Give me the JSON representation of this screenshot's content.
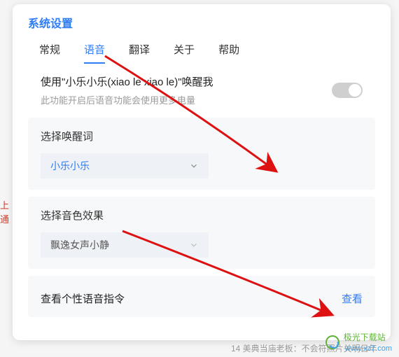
{
  "title": "系统设置",
  "tabs": [
    {
      "label": "常规"
    },
    {
      "label": "语音",
      "active": true
    },
    {
      "label": "翻译"
    },
    {
      "label": "关于"
    },
    {
      "label": "帮助"
    }
  ],
  "wake": {
    "main": "使用\"小乐小乐(xiao le xiao le)\"唤醒我",
    "sub": "此功能开启后语音功能会使用更多电量"
  },
  "wakeword": {
    "title": "选择唤醒词",
    "value": "小乐小乐"
  },
  "voice": {
    "title": "选择音色效果",
    "value": "飘逸女声小静"
  },
  "commands": {
    "title": "查看个性语音指令",
    "link": "查看"
  },
  "side": {
    "l1": "上",
    "l2": "通"
  },
  "watermark": {
    "brand": "极光下载站",
    "url": "www.xz7.com"
  },
  "bottom_hint": "14  美典当庙老板：不会符照片关明日年"
}
